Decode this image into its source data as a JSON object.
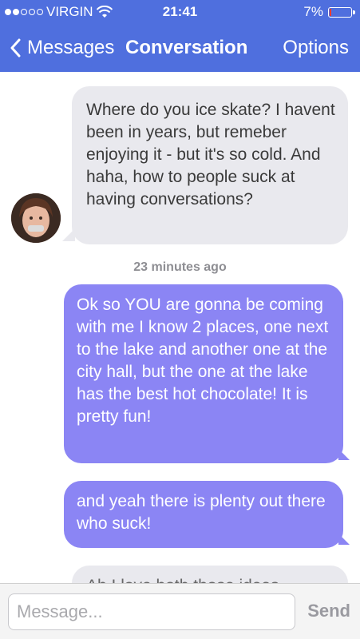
{
  "status_bar": {
    "carrier": "VIRGIN",
    "time": "21:41",
    "battery_text": "7%",
    "battery_level": 0.07,
    "signal_bars_filled": 2,
    "signal_bars_total": 5
  },
  "nav": {
    "back_label": "Messages",
    "title": "Conversation",
    "options_label": "Options"
  },
  "messages": [
    {
      "direction": "incoming",
      "text": "Where do you ice skate? I havent been in years, but remeber enjoying it - but it's so cold. And haha, how to people suck at having conversations?"
    },
    {
      "direction": "outgoing",
      "text": "Ok so YOU are gonna be coming with me I know 2 places, one next to the lake and another one at the city hall, but the one at the lake has the best hot chocolate! It is pretty fun!"
    },
    {
      "direction": "outgoing",
      "text": "and yeah there is plenty out there who suck!"
    },
    {
      "direction": "incoming",
      "text": "Ah I love both those ideas..."
    }
  ],
  "timestamp": "23 minutes ago",
  "composer": {
    "placeholder": "Message...",
    "send_label": "Send"
  },
  "colors": {
    "nav_bar": "#4f6fde",
    "outgoing_bubble": "#8b85f4",
    "incoming_bubble": "#e9e9ee"
  }
}
